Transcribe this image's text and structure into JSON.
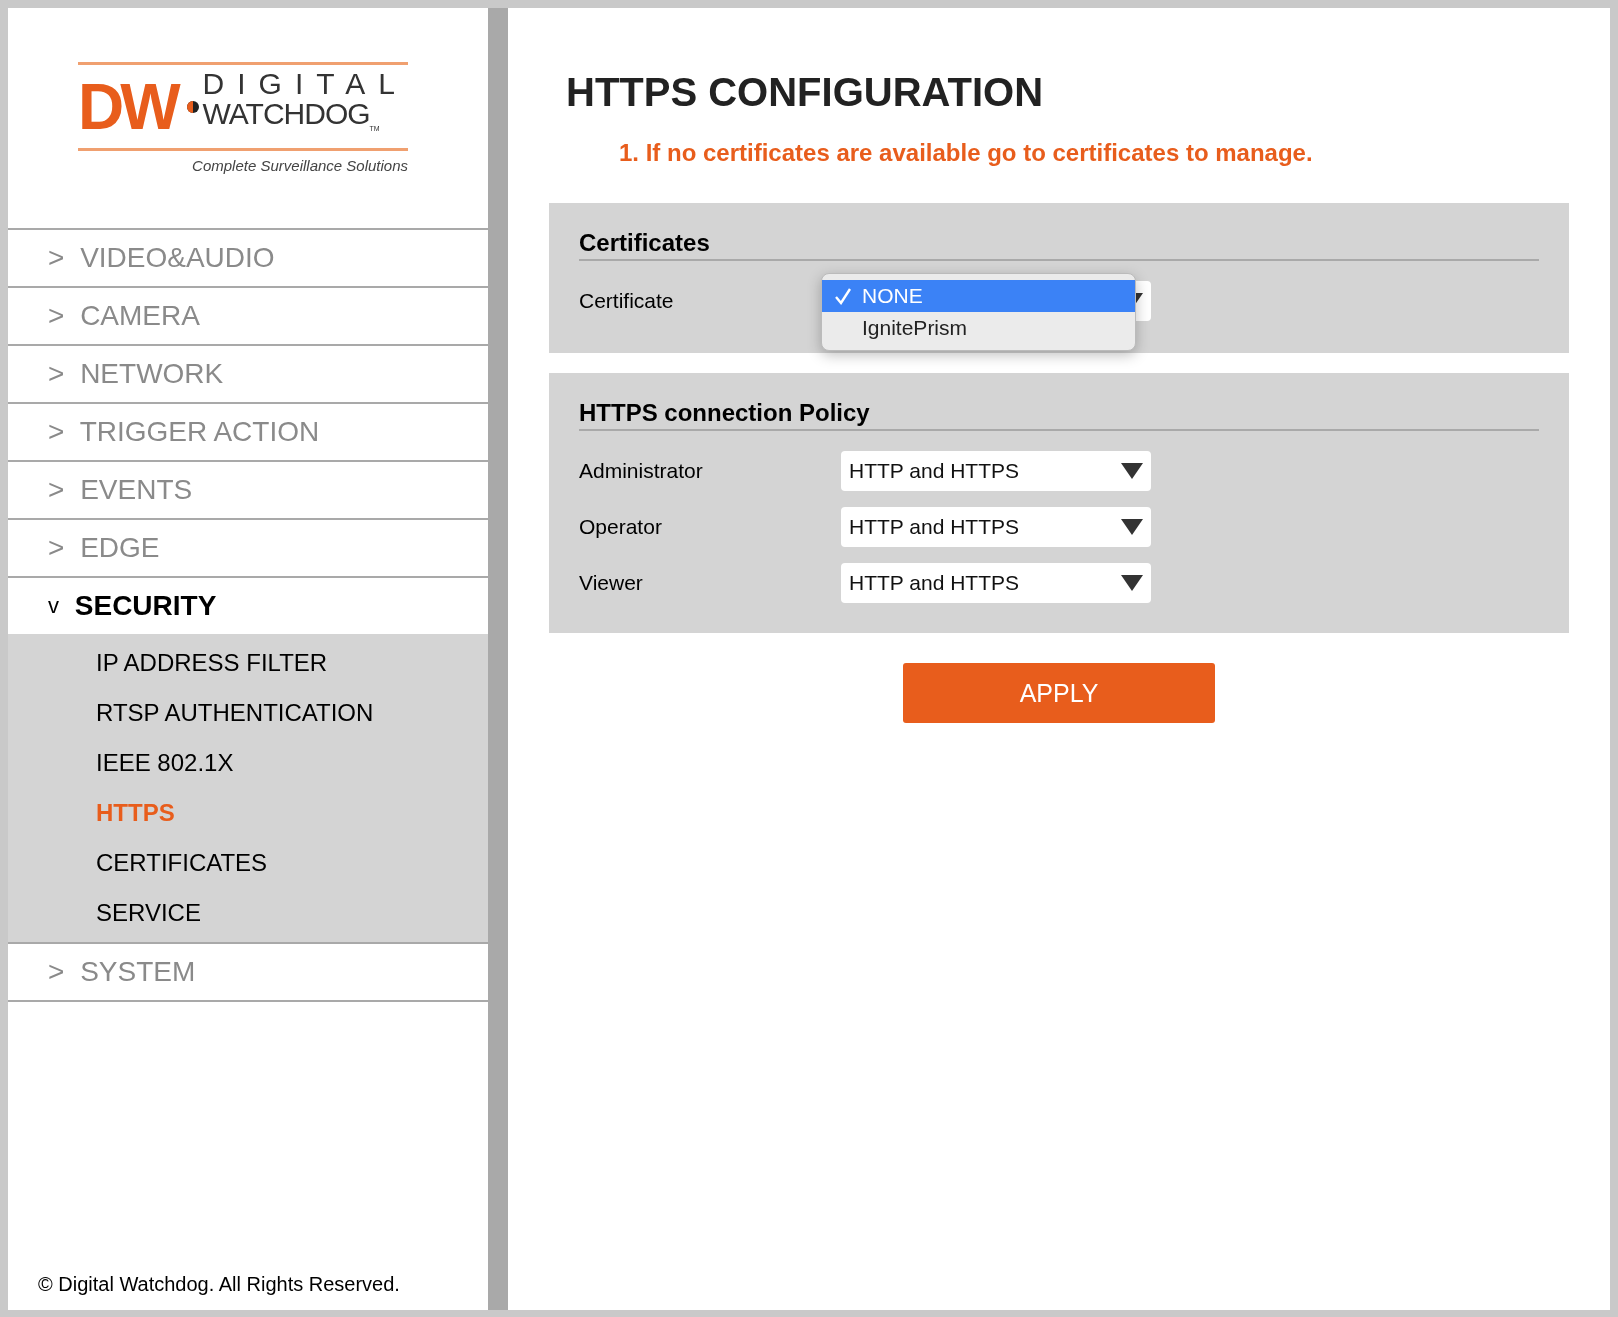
{
  "logo": {
    "mark": "DW",
    "line_1": "DIGITAL",
    "line_2": "WATCHDOG",
    "trademark": "TM",
    "tagline": "Complete Surveillance Solutions"
  },
  "sidebar": {
    "items": [
      {
        "arrow": ">",
        "label": "VIDEO&AUDIO",
        "expanded": false
      },
      {
        "arrow": ">",
        "label": "CAMERA",
        "expanded": false
      },
      {
        "arrow": ">",
        "label": "NETWORK",
        "expanded": false
      },
      {
        "arrow": ">",
        "label": "TRIGGER ACTION",
        "expanded": false
      },
      {
        "arrow": ">",
        "label": "EVENTS",
        "expanded": false
      },
      {
        "arrow": ">",
        "label": "EDGE",
        "expanded": false
      },
      {
        "arrow": "v",
        "label": "SECURITY",
        "expanded": true,
        "children": [
          {
            "label": "IP ADDRESS FILTER",
            "selected": false
          },
          {
            "label": "RTSP AUTHENTICATION",
            "selected": false
          },
          {
            "label": "IEEE 802.1X",
            "selected": false
          },
          {
            "label": "HTTPS",
            "selected": true
          },
          {
            "label": "CERTIFICATES",
            "selected": false
          },
          {
            "label": "SERVICE",
            "selected": false
          }
        ]
      },
      {
        "arrow": ">",
        "label": "SYSTEM",
        "expanded": false
      }
    ],
    "copyright": "© Digital Watchdog. All Rights Reserved."
  },
  "page": {
    "title": "HTTPS CONFIGURATION",
    "note": "1. If no certificates are available go to certificates to manage."
  },
  "certificates": {
    "heading": "Certificates",
    "label": "Certificate",
    "options": [
      {
        "label": "NONE",
        "selected": true
      },
      {
        "label": "IgnitePrism",
        "selected": false
      }
    ]
  },
  "policy": {
    "heading": "HTTPS connection Policy",
    "rows": [
      {
        "label": "Administrator",
        "value": "HTTP and HTTPS"
      },
      {
        "label": "Operator",
        "value": "HTTP and HTTPS"
      },
      {
        "label": "Viewer",
        "value": "HTTP and HTTPS"
      }
    ]
  },
  "apply_button": "APPLY"
}
